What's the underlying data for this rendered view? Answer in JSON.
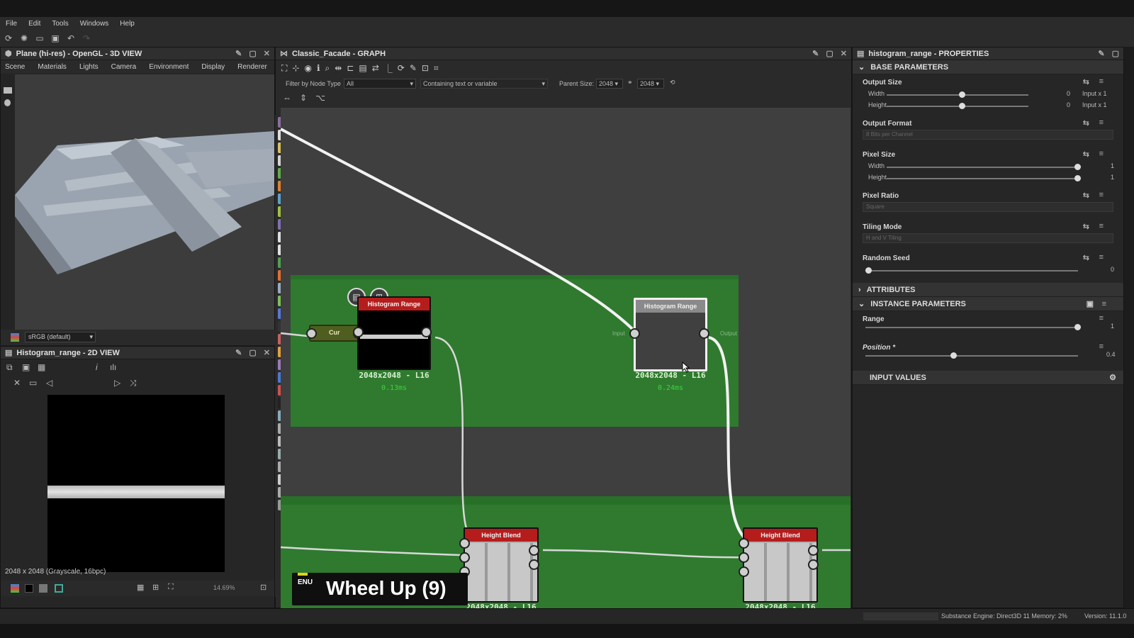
{
  "menu": [
    "File",
    "Edit",
    "Tools",
    "Windows",
    "Help"
  ],
  "view3d": {
    "title": "Plane (hi-res) - OpenGL - 3D VIEW",
    "submenu": [
      "Scene",
      "Materials",
      "Lights",
      "Camera",
      "Environment",
      "Display",
      "Renderer"
    ],
    "color_space": "sRGB (default)"
  },
  "view2d": {
    "title": "Histogram_range - 2D VIEW",
    "info": "2048 x 2048 (Grayscale, 16bpc)",
    "zoom": "14.69%"
  },
  "graph": {
    "title": "Classic_Facade - GRAPH",
    "filter_label": "Filter by Node Type",
    "filter_value": "All",
    "contains_placeholder": "Containing text or variable",
    "parent_size_label": "Parent Size:",
    "parent_w": "2048",
    "parent_h": "2048",
    "nodes": {
      "cur_label": "Cur",
      "hr1_title": "Histogram Range",
      "hr1_info": "2048x2048 - L16",
      "hr1_time": "0.13ms",
      "hr2_title": "Histogram Range",
      "hr2_info": "2048x2048 - L16",
      "hr2_time": "0.24ms",
      "hr2_in": "Input",
      "hr2_out": "Output",
      "hb1_title": "Height Blend",
      "hb1_info": "2048x2048 - L16",
      "hb2_title": "Height Blend",
      "hb2_info": "2048x2048 - L16"
    },
    "overlay": {
      "lang": "ENU",
      "text": "Wheel Up (9)"
    }
  },
  "props": {
    "title": "histogram_range - PROPERTIES",
    "base": "BASE PARAMETERS",
    "output_size": "Output Size",
    "width": "Width",
    "height": "Height",
    "os_w_val": "0",
    "os_h_val": "0",
    "os_w_rel": "Input x 1",
    "os_h_rel": "Input x 1",
    "output_format": "Output Format",
    "output_format_val": "8 Bits per Channel",
    "pixel_size": "Pixel Size",
    "ps_w_val": "1",
    "ps_h_val": "1",
    "pixel_ratio": "Pixel Ratio",
    "pixel_ratio_val": "Square",
    "tiling_mode": "Tiling Mode",
    "tiling_mode_val": "H and V Tiling",
    "random_seed": "Random Seed",
    "random_seed_val": "0",
    "attributes": "ATTRIBUTES",
    "instance": "INSTANCE PARAMETERS",
    "range": "Range",
    "range_val": "1",
    "position": "Position *",
    "position_val": "0.4",
    "input_values": "INPUT VALUES"
  },
  "status": {
    "engine": "Substance Engine: Direct3D 11  Memory: 2%",
    "version": "Version: 11.1.0"
  }
}
